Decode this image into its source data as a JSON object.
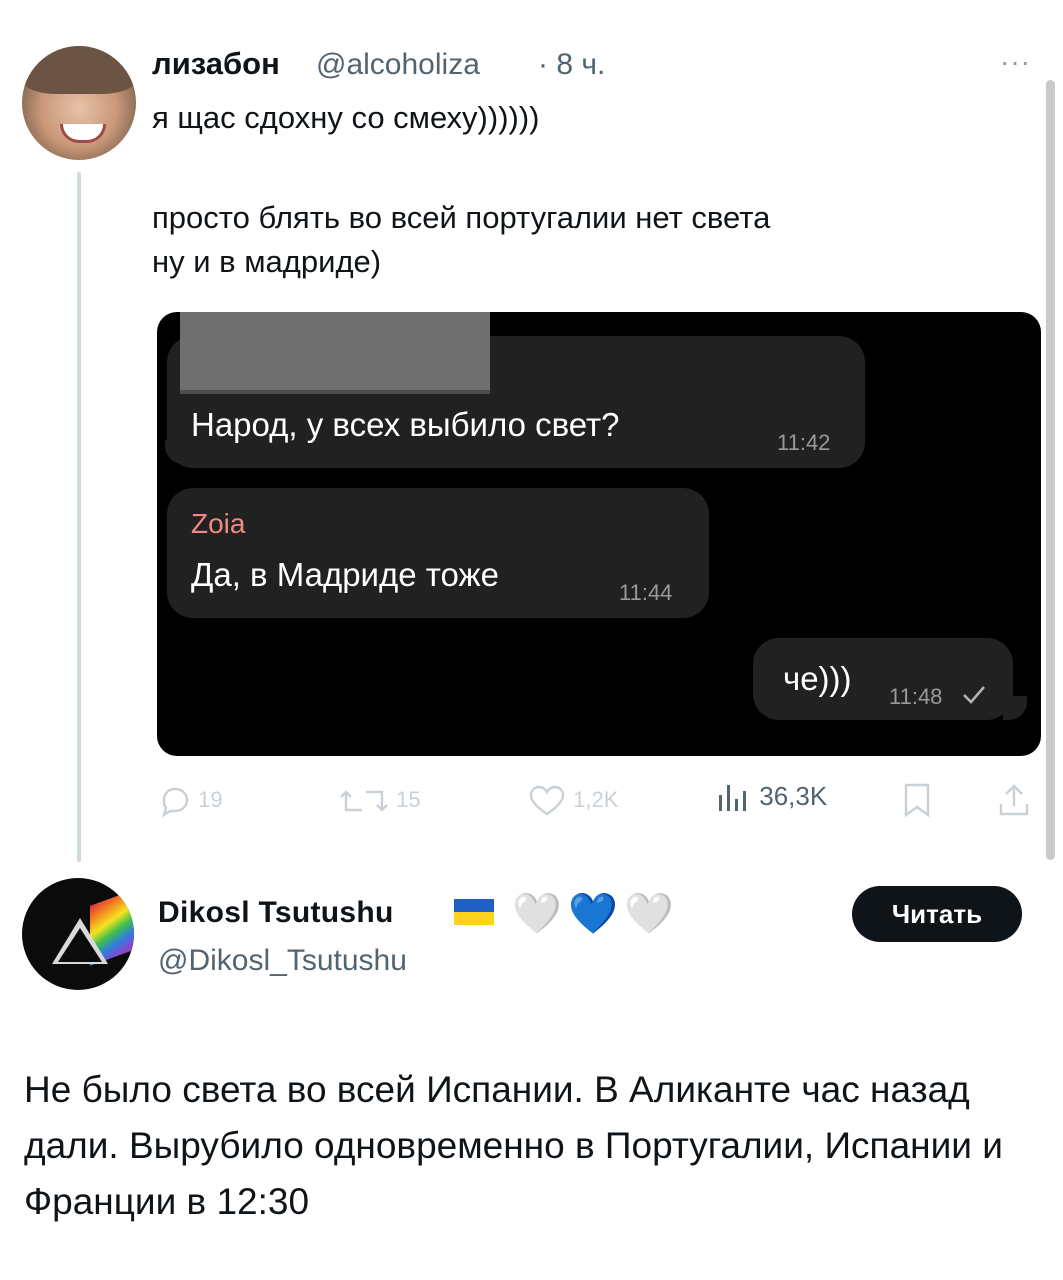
{
  "tweet1": {
    "name": "лизабон",
    "handle": "@alcoholiza",
    "time": "· 8 ч.",
    "more": "···",
    "text_line1": "я щас сдохну со смеху))))))",
    "text_line2": "просто блять во всей португалии нет света",
    "text_line3": "ну и в мадриде)",
    "media": {
      "msg1": {
        "text": "Народ, у всех выбило свет?",
        "time": "11:42"
      },
      "msg2": {
        "sender": "Zoia",
        "text": "Да, в Мадриде тоже",
        "time": "11:44"
      },
      "msg3": {
        "text": "че)))",
        "time": "11:48",
        "status_icon": "check-icon"
      }
    },
    "actions": {
      "replies": "19",
      "retweets": "15",
      "likes": "1,2K",
      "views": "36,3K"
    }
  },
  "tweet2": {
    "name": "Dikosl Tsutushu",
    "handle": "@Dikosl_Tsutushu",
    "hearts": [
      "🤍",
      "💙",
      "🤍"
    ],
    "follow_label": "Читать",
    "body": "Не было света во всей Испании. В Аликанте час назад дали. Вырубило одновременно в Португалии, Испании и Франции в 12:30"
  },
  "colors": {
    "sender_name": "#f08a80",
    "follow_button": "#0f1419",
    "flag_blue": "#1f5fc4",
    "flag_yellow": "#ffd21f"
  }
}
